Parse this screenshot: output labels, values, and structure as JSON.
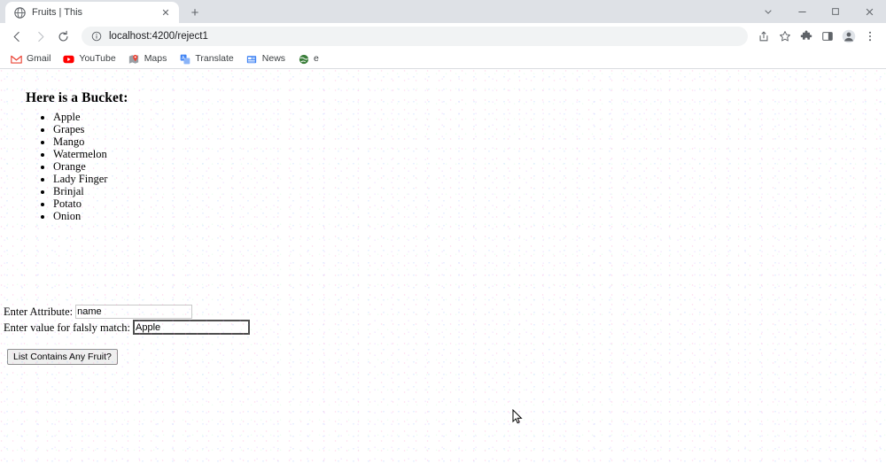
{
  "window": {
    "controls": [
      {
        "name": "tab-search-button",
        "glyph": "⌄"
      },
      {
        "name": "minimize-button",
        "glyph": "—"
      },
      {
        "name": "maximize-button",
        "glyph": "▢"
      },
      {
        "name": "close-button",
        "glyph": "✕"
      }
    ]
  },
  "tabstrip": {
    "tabs": [
      {
        "title": "Fruits | This",
        "favicon": "globe-icon",
        "close_glyph": "✕"
      }
    ],
    "new_tab_glyph": "+"
  },
  "toolbar": {
    "back_glyph": "←",
    "forward_glyph": "→",
    "reload_glyph": "⟳",
    "omnibox": {
      "info_glyph": "ⓘ",
      "url": "localhost:4200/reject1"
    },
    "actions": [
      {
        "name": "share-icon",
        "glyph": "⇪"
      },
      {
        "name": "bookmark-star-icon",
        "glyph": "☆"
      },
      {
        "name": "extensions-puzzle-icon",
        "glyph": "🧩"
      },
      {
        "name": "side-panel-icon",
        "glyph": "▣"
      },
      {
        "name": "profile-avatar-icon",
        "glyph": "👤"
      },
      {
        "name": "chrome-menu-icon",
        "glyph": "⋮"
      }
    ]
  },
  "bookmarks": [
    {
      "label": "Gmail",
      "icon": "gmail-icon",
      "color": "#ea4335"
    },
    {
      "label": "YouTube",
      "icon": "youtube-icon",
      "color": "#ff0000"
    },
    {
      "label": "Maps",
      "icon": "maps-icon",
      "color": "#4285f4"
    },
    {
      "label": "Translate",
      "icon": "translate-icon",
      "color": "#4285f4"
    },
    {
      "label": "News",
      "icon": "news-icon",
      "color": "#4285f4"
    },
    {
      "label": "e",
      "icon": "globe-icon",
      "color": "#3b7f3b"
    }
  ],
  "page": {
    "heading": "Here is a Bucket:",
    "bucket_items": [
      "Apple",
      "Grapes",
      "Mango",
      "Watermelon",
      "Orange",
      "Lady Finger",
      "Brinjal",
      "Potato",
      "Onion"
    ],
    "form": {
      "attribute_label": "Enter Attribute:",
      "attribute_value": "name",
      "attribute_placeholder": "",
      "match_label": "Enter value for falsly match:",
      "match_value": "Apple",
      "match_placeholder": "",
      "submit_label": "List Contains Any Fruit?"
    }
  },
  "colors": {
    "tabstrip_bg": "#dee1e6",
    "omnibox_bg": "#f1f3f4",
    "page_bg": "#ffffff",
    "text": "#202124"
  }
}
